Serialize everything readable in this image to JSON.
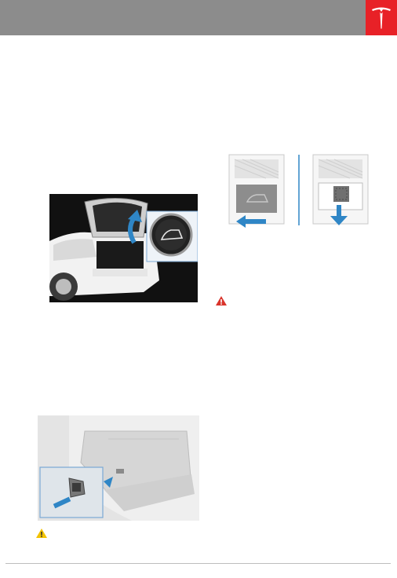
{
  "page": {
    "brand_logo": "tesla-logo-icon",
    "colors": {
      "header_bar": "#8c8c8c",
      "brand_red": "#e82127",
      "illustration_blue": "#2f86c6",
      "warning_red": "#d9342b",
      "caution_yellow": "#f2c200"
    }
  },
  "figures": [
    {
      "name": "liftgate-open-button-figure",
      "icon": "open-liftgate-icon"
    },
    {
      "name": "manual-release-hatch-figure",
      "icons": [
        "open-liftgate-icon",
        "arrow-left-icon",
        "arrow-down-icon"
      ]
    },
    {
      "name": "rear-trunk-switch-figure",
      "icon": "arrow-right-icon"
    }
  ],
  "notices": [
    {
      "name": "warning-icon-right",
      "icon": "warning-triangle-red"
    },
    {
      "name": "caution-icon-left",
      "icon": "caution-triangle-yellow"
    }
  ]
}
